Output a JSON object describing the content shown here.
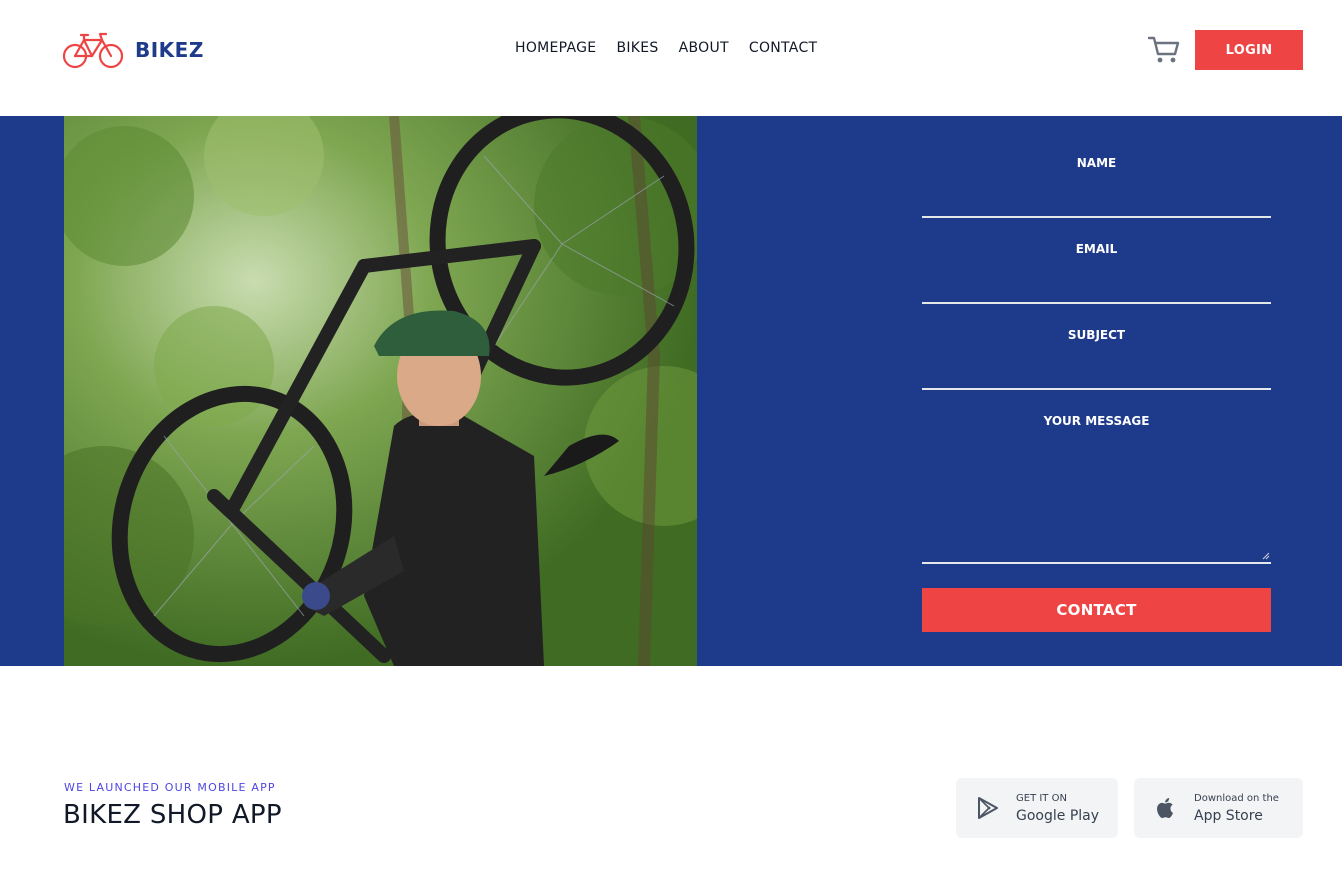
{
  "brand": {
    "name": "BIKEZ",
    "logo_icon": "bicycle-icon",
    "accent": "#ef4444",
    "primary": "#1e3a8a"
  },
  "nav": [
    {
      "label": "HOMEPAGE"
    },
    {
      "label": "BIKES"
    },
    {
      "label": "ABOUT"
    },
    {
      "label": "CONTACT"
    }
  ],
  "header": {
    "cart_icon": "cart-icon",
    "login_label": "LOGIN"
  },
  "form": {
    "name_label": "NAME",
    "email_label": "EMAIL",
    "subject_label": "SUBJECT",
    "message_label": "YOUR MESSAGE",
    "submit_label": "CONTACT"
  },
  "app": {
    "kicker": "WE LAUNCHED OUR MOBILE APP",
    "title": "BIKEZ SHOP APP",
    "google": {
      "small": "GET IT ON",
      "big": "Google Play",
      "icon": "play-icon"
    },
    "apple": {
      "small": "Download on the",
      "big": "App Store",
      "icon": "apple-icon"
    }
  }
}
